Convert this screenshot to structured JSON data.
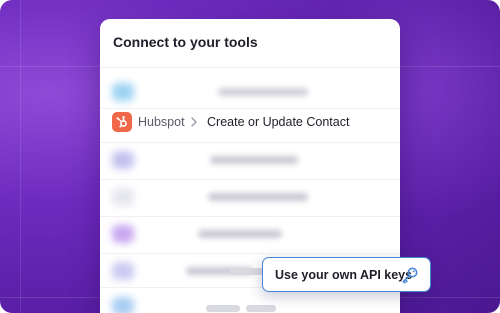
{
  "card": {
    "title": "Connect to your tools"
  },
  "selected_app": {
    "name": "Hubspot",
    "icon": "hubspot-icon",
    "icon_color": "#f0674a",
    "action": "Create or Update Contact"
  },
  "api_keys": {
    "label": "Use your own API keys",
    "icon": "key-icon",
    "accent": "#4a86d8"
  },
  "colors": {
    "background": "#5a1fa6",
    "card": "#ffffff"
  }
}
